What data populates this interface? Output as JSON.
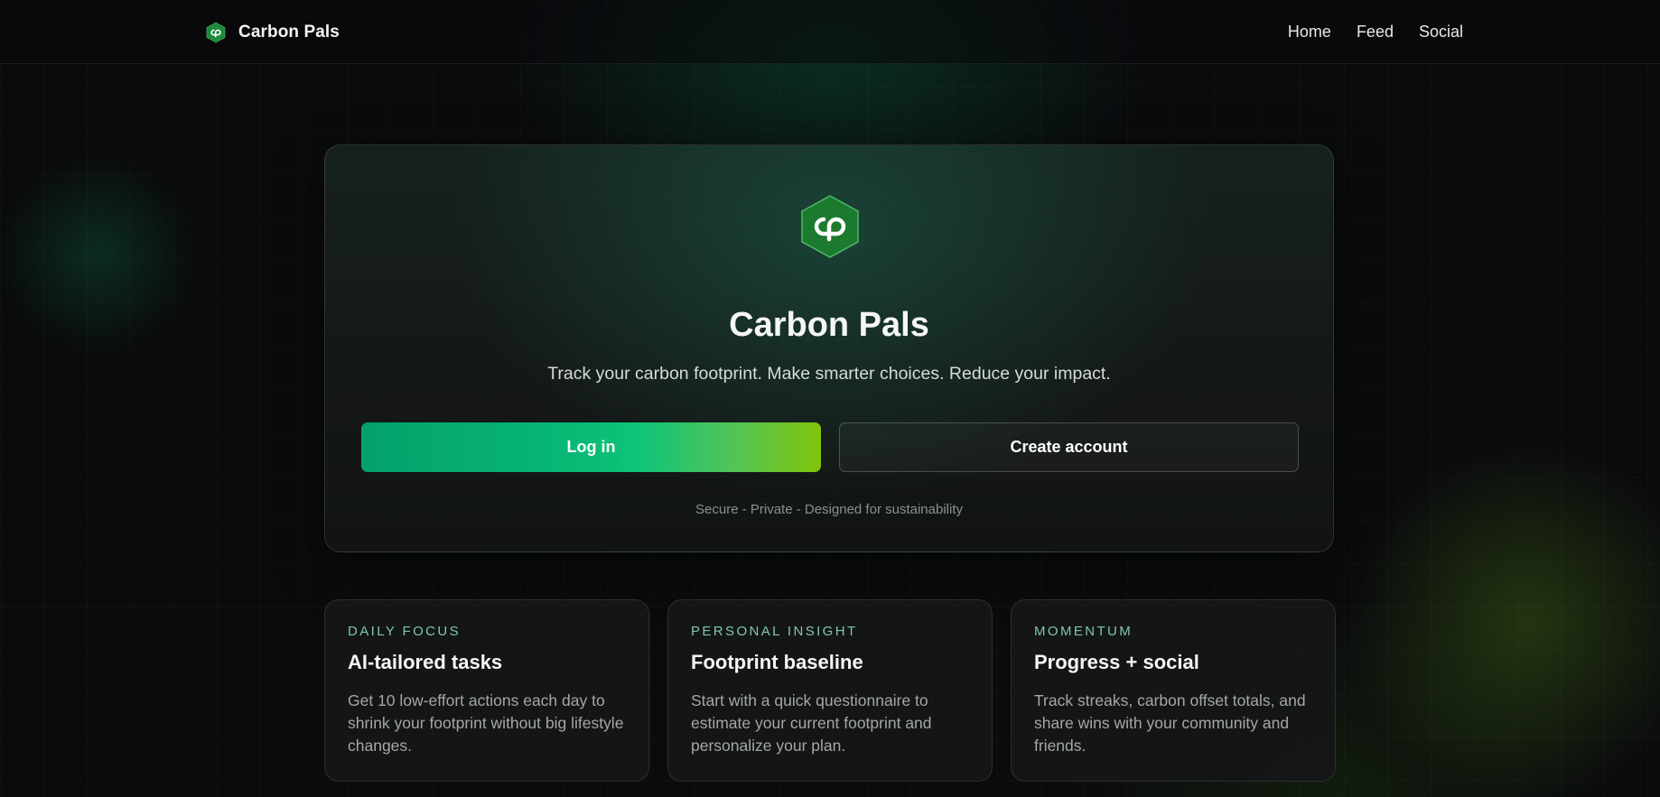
{
  "app": {
    "brand_name": "Carbon Pals",
    "brand_color": "#1e8a3c",
    "accent_gradient": [
      "#05a06b",
      "#82c40a"
    ],
    "logo_icon": "carbon-pals-hexagon-logo"
  },
  "nav": {
    "items": [
      {
        "label": "Home"
      },
      {
        "label": "Feed"
      },
      {
        "label": "Social"
      }
    ]
  },
  "hero": {
    "title": "Carbon Pals",
    "subtitle": "Track your carbon footprint. Make smarter choices. Reduce your impact.",
    "login_label": "Log in",
    "create_account_label": "Create account",
    "footnote": "Secure - Private - Designed for sustainability"
  },
  "features": [
    {
      "kicker": "DAILY FOCUS",
      "title": "AI-tailored tasks",
      "body": "Get 10 low-effort actions each day to shrink your footprint without big lifestyle changes."
    },
    {
      "kicker": "PERSONAL INSIGHT",
      "title": "Footprint baseline",
      "body": "Start with a quick questionnaire to estimate your current footprint and personalize your plan."
    },
    {
      "kicker": "MOMENTUM",
      "title": "Progress + social",
      "body": "Track streaks, carbon offset totals, and share wins with your community and friends."
    }
  ]
}
